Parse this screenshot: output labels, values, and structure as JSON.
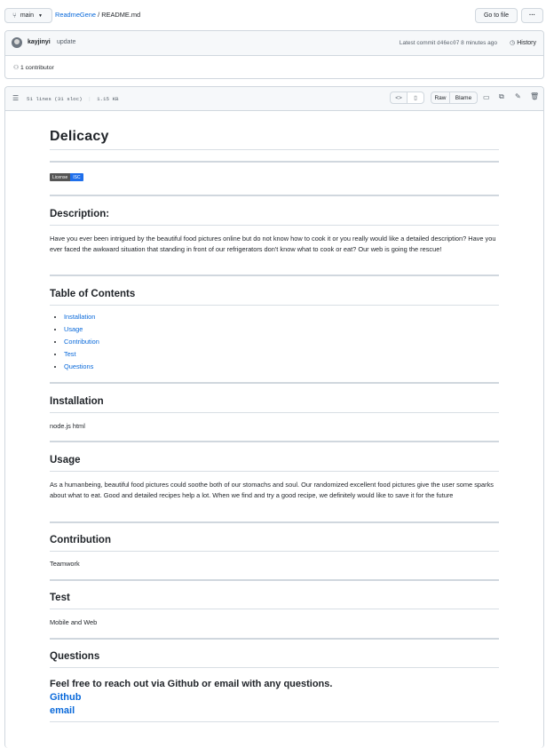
{
  "topbar": {
    "branch": "main",
    "repo": "ReadmeGene",
    "separator": "/",
    "file": "README.md",
    "go_to_file": "Go to file",
    "more": "···"
  },
  "commit": {
    "author": "kayjinyi",
    "message": "update",
    "latest_label": "Latest commit",
    "hash": "d46ec07",
    "time": "8 minutes ago",
    "history": "History"
  },
  "contributors": {
    "label": "1 contributor"
  },
  "file_header": {
    "lines": "51 lines (31 sloc)",
    "size": "1.15 KB",
    "raw": "Raw",
    "blame": "Blame"
  },
  "readme": {
    "title": "Delicacy",
    "badge": {
      "left": "License",
      "right": "ISC",
      "right_color": "#1f6feb"
    },
    "description_heading": "Description:",
    "description_text": "Have you ever been intrigued by the beautiful food pictures online but do not know how to cook it or you really would like a detailed description? Have you ever faced the awkward situation that standing in front of our refrigerators don't know what to cook or eat? Our web is going the rescue!",
    "toc_heading": "Table of Contents",
    "toc_items": [
      "Installation",
      "Usage",
      "Contribution",
      "Test",
      "Questions"
    ],
    "installation_heading": "Installation",
    "installation_text": "node.js html",
    "usage_heading": "Usage",
    "usage_text": "As a humanbeing, beautiful food pictures could soothe both of our stomachs and soul. Our randomized excellent food pictures give the user some sparks about what to eat. Good and detailed recipes help a lot. When we find and try a good recipe, we definitely would like to save it for the future",
    "contribution_heading": "Contribution",
    "contribution_text": "Teamwork",
    "test_heading": "Test",
    "test_text": "Mobile and Web",
    "questions_heading": "Questions",
    "questions_text": "Feel free to reach out via Github or email with any questions.",
    "github_link": "Github",
    "email_link": "email"
  }
}
